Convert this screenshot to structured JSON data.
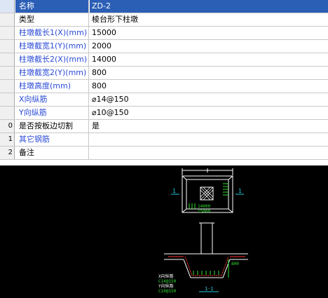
{
  "properties": [
    {
      "index": "",
      "name": "名称",
      "value": "ZD-2",
      "selected": true
    },
    {
      "index": "",
      "name": "类型",
      "value": "棱台形下柱墩",
      "selected": false
    },
    {
      "index": "",
      "name": "柱墩截长1(X)(mm)",
      "value": "15000",
      "selected": false
    },
    {
      "index": "",
      "name": "柱墩截宽1(Y)(mm)",
      "value": "2000",
      "selected": false
    },
    {
      "index": "",
      "name": "柱墩截长2(X)(mm)",
      "value": "14000",
      "selected": false
    },
    {
      "index": "",
      "name": "柱墩截宽2(Y)(mm)",
      "value": "800",
      "selected": false
    },
    {
      "index": "",
      "name": "柱墩高度(mm)",
      "value": "800",
      "selected": false
    },
    {
      "index": "",
      "name": "X向纵筋",
      "value": "⌀14@150",
      "selected": false
    },
    {
      "index": "",
      "name": "Y向纵筋",
      "value": "⌀10@150",
      "selected": false
    },
    {
      "index": "0",
      "name": "是否按板边切割",
      "value": "是",
      "selected": false
    },
    {
      "index": "1",
      "name": "其它钢筋",
      "value": "",
      "selected": false
    },
    {
      "index": "2",
      "name": "备注",
      "value": "",
      "selected": false
    }
  ],
  "drawing": {
    "section_mark_left": "1",
    "section_mark_right": "1",
    "dim_top": "15000",
    "dim_bottom": "15000",
    "dim_text_mid": "14000",
    "label_x_bars": "X向纵筋",
    "label_y_bars": "Y向纵筋",
    "rebar_spec_1": "C14@150",
    "rebar_spec_2": "C10@150",
    "section_title": "1-1",
    "dim_side": "800"
  },
  "colors": {
    "selected_row": "#2b5fb6",
    "blue_label": "#2a4bd7",
    "cad_background": "#000000",
    "cad_white": "#ffffff",
    "cad_green": "#33dd33",
    "cad_red": "#ff3030",
    "cad_cyan": "#22c8e0"
  }
}
